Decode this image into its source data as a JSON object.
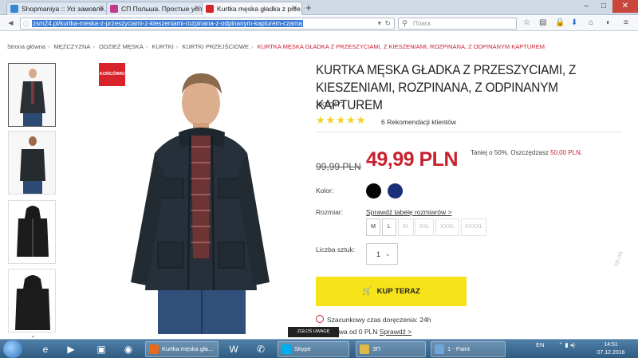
{
  "browser": {
    "tabs": [
      {
        "label": "Shopmaniya :: Усі замовле...",
        "active": false,
        "color": "#3b86d1"
      },
      {
        "label": "СП Польша. Простые усл...",
        "active": false,
        "color": "#c23a8b"
      },
      {
        "label": "Kurtka męska gładka z prze...",
        "active": true,
        "color": "#d8232a"
      }
    ],
    "url": "zsm24.pl/kurtka-meska-z-przeszyciami-z-kieszeniami-rozpinana-z-odpinanym-kapturem-czarna",
    "search_placeholder": "Поиск"
  },
  "breadcrumb": [
    "Strona główna",
    "MĘŻCZYZNA",
    "ODZIEŻ MĘSKA",
    "KURTKI",
    "KURTKI PRZEJŚCIOWE"
  ],
  "breadcrumb_current": "KURTKA MĘSKA GŁADKA Z PRZESZYCIAMI, Z KIESZENIAMI, ROZPINANA, Z ODPINANYM KAPTUREM",
  "badge": "KOŃCÓWKI",
  "product": {
    "title": "KURTKA MĘSKA GŁADKA Z PRZESZYCIAMI, Z KIESZENIAMI, ROZPINANA, Z ODPINANYM KAPTUREM",
    "sku": "XKP0477",
    "rating": 5,
    "reviews": "6 Rekomendacji klientów",
    "old_price": "99,99 PLN",
    "new_price": "49,99 PLN",
    "savings_text": "Taniej o 50%. Oszczędzasz",
    "savings_amount": "50,00 PLN.",
    "color_label": "Kolor:",
    "colors": [
      "#050505",
      "#1b2f79"
    ],
    "size_label": "Rozmiar:",
    "size_chart_link": "Sprawdź tabelę rozmiarów >",
    "sizes": [
      {
        "label": "M",
        "available": true
      },
      {
        "label": "L",
        "available": true
      },
      {
        "label": "XL",
        "available": false
      },
      {
        "label": "XXL",
        "available": false
      },
      {
        "label": "XXXL",
        "available": false
      },
      {
        "label": "XXXXL",
        "available": false
      }
    ],
    "qty_label": "Liczba sztuk:",
    "qty_value": "1",
    "buy_label": "KUP TERAZ",
    "delivery_text": "Szacunkowy czas doręczenia: 24h",
    "shipping_text": "awa od 0 PLN",
    "shipping_link": "Sprawdź >"
  },
  "report_button": "ZGŁOŚ UWAGĘ",
  "taskbar": {
    "windows": [
      {
        "label": "Kurtka męska gła...",
        "color": "#e76b1c"
      },
      {
        "label": "Skype",
        "color": "#00aff0"
      },
      {
        "label": "ЗП",
        "color": "#e0b949"
      },
      {
        "label": "1 - Paint",
        "color": "#6fa6d8"
      }
    ],
    "lang": "EN",
    "time": "14:51",
    "date": "07.12.2016"
  }
}
